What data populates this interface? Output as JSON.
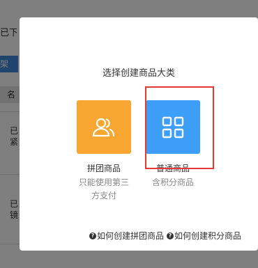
{
  "background": {
    "tab_text": "已下",
    "button_text": "架",
    "header_text": "名",
    "cells": [
      "已紧",
      "已镜"
    ]
  },
  "modal": {
    "title": "选择创建商品大类",
    "options": [
      {
        "name": "拼团商品",
        "desc": "只能使用第三方支付",
        "icon": "users-icon",
        "color": "#f7a731"
      },
      {
        "name": "普通商品",
        "desc": "含积分商品",
        "icon": "grid-icon",
        "color": "#3d9ef8"
      }
    ],
    "help_links": [
      {
        "icon": "question-icon",
        "label": "如何创建拼团商品"
      },
      {
        "icon": "question-icon",
        "label": "如何创建积分商品"
      }
    ],
    "highlight_color": "#e53935"
  }
}
